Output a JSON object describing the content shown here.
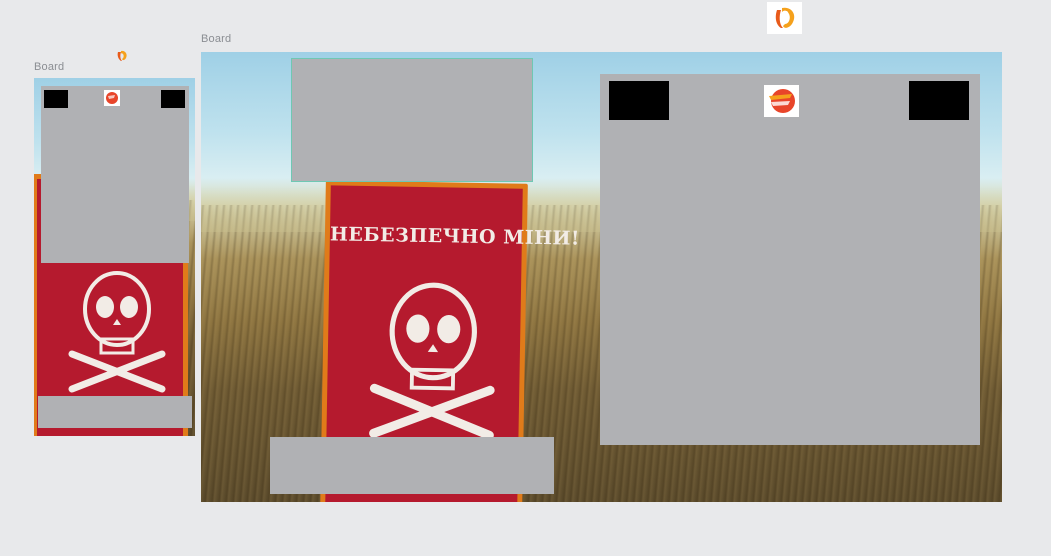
{
  "boards": [
    {
      "label": "Board"
    },
    {
      "label": "Board"
    }
  ],
  "sign": {
    "text": "НЕБЕЗПЕЧНО МІНИ!"
  },
  "icons": {
    "top_logo": "app-logo-icon",
    "small_board_logo": "brand-logo-icon",
    "small_board_mini_logo": "brand-logo-icon",
    "large_board_logo": "brand-logo-icon",
    "skull": "skull-crossbones-icon"
  },
  "colors": {
    "background": "#e8e9eb",
    "placeholder": "#b0b1b4",
    "selection_outline": "#6fc8b3",
    "sign_red": "#b51a2e",
    "sign_border": "#e07b1a",
    "logo_orange": "#f07d1e"
  }
}
